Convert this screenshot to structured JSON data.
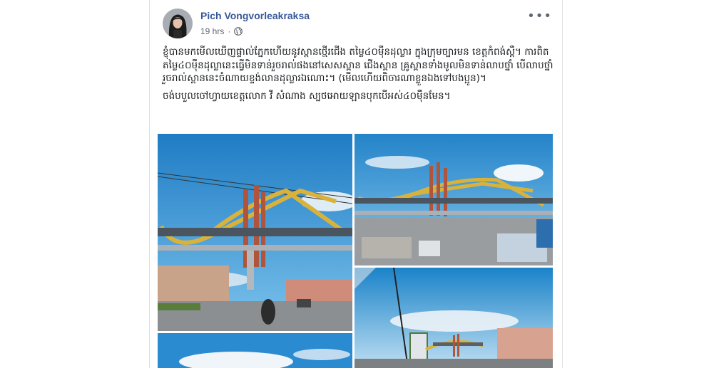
{
  "post": {
    "author": "Pich Vongvorleakraksa",
    "time": "19 hrs",
    "privacy_icon": "globe-icon",
    "options_icon": "more-options-icon",
    "body": [
      "ខ្ញុំបានមកមើលឃើញផ្ទាល់ភ្នែកហើយនូវស្ពានថ្មើរជើង តម្លៃ៤០ម៉ឺនដុល្លារ ក្នុងក្រុមច្បារមន ខេត្តកំពង់ស្ពឺ។ ការពិតតម្លៃ៤០ម៉ឺនដុល្លានេះធ្វើមិនទាន់រួចរាល់ផងនៅសេសស្ពាន ជើងស្ពាន គ្រូស្ពានទាំងមូលមិនទាន់លាបថ្នាំ បើលាបថ្នាំរួចរាល់ស្ពាននេះចំណាយខ្ទង់លានដុល្លារឯណោះ។ (មើលហើយពិចារណាខ្លួនឯងទៅបងប្អូន)។",
      "ចង់បបួលចៅហ្វាយខេត្តលោក វី សំណាង ស្បថអោយឡានបុកបើអស់៤០ម៉ឺនមែន។"
    ]
  },
  "photos": [
    {
      "name": "photo-1"
    },
    {
      "name": "photo-2"
    },
    {
      "name": "photo-3"
    },
    {
      "name": "photo-4"
    },
    {
      "name": "photo-5"
    }
  ],
  "colors": {
    "link": "#385898",
    "meta": "#606770",
    "text": "#1c1e21",
    "sky": "#2f8fd0",
    "bridge_yellow": "#d9b23c",
    "bridge_red": "#b0543c"
  }
}
